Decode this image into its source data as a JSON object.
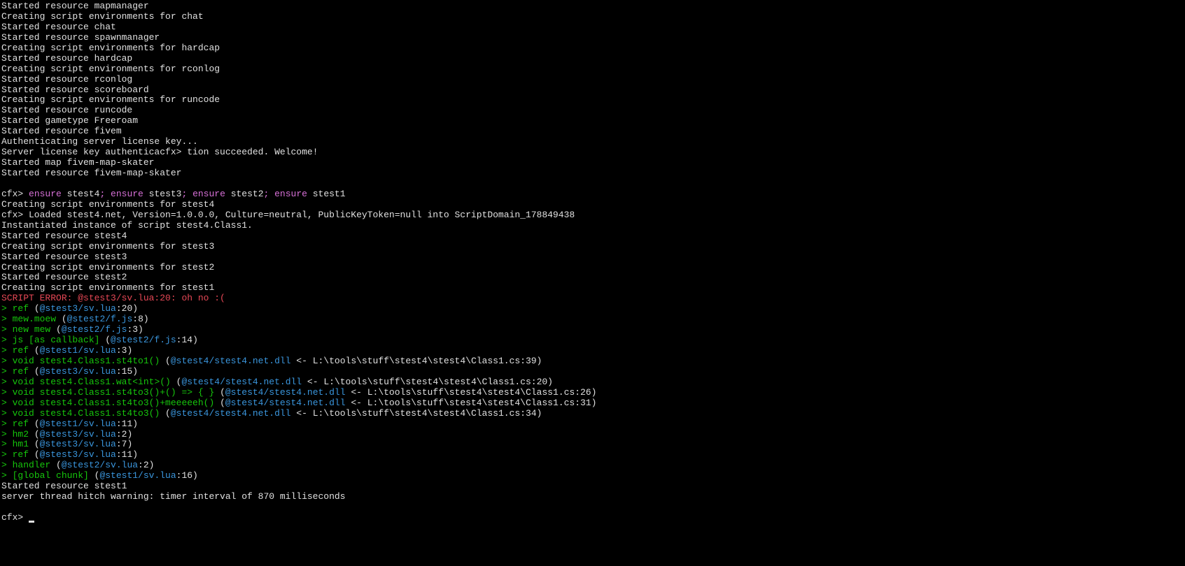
{
  "startup": {
    "l1": "Started resource mapmanager",
    "l2": "Creating script environments for chat",
    "l3": "Started resource chat",
    "l4": "Started resource spawnmanager",
    "l5": "Creating script environments for hardcap",
    "l6": "Started resource hardcap",
    "l7": "Creating script environments for rconlog",
    "l8": "Started resource rconlog",
    "l9": "Started resource scoreboard",
    "l10": "Creating script environments for runcode",
    "l11": "Started resource runcode",
    "l12": "Started gametype Freeroam",
    "l13": "Started resource fivem",
    "l14": "Authenticating server license key...",
    "l15": "Server license key authenticacfx> tion succeeded. Welcome!",
    "l16": "Started map fivem-map-skater",
    "l17": "Started resource fivem-map-skater"
  },
  "command": {
    "prompt": "cfx> ",
    "cmd1": "ensure",
    "arg1": " stest4",
    "sep1": "; ",
    "cmd2": "ensure",
    "arg2": " stest3",
    "sep2": "; ",
    "cmd3": "ensure",
    "arg3": " stest2",
    "sep3": "; ",
    "cmd4": "ensure",
    "arg4": " stest1"
  },
  "output": {
    "o1": "Creating script environments for stest4",
    "o2": "cfx> Loaded stest4.net, Version=1.0.0.0, Culture=neutral, PublicKeyToken=null into ScriptDomain_178849438",
    "o3": "Instantiated instance of script stest4.Class1.",
    "o4": "Started resource stest4",
    "o5": "Creating script environments for stest3",
    "o6": "Started resource stest3",
    "o7": "Creating script environments for stest2",
    "o8": "Started resource stest2",
    "o9": "Creating script environments for stest1"
  },
  "error": {
    "msg": "SCRIPT ERROR: @stest3/sv.lua:20: oh no :("
  },
  "trace": {
    "t1_pre": "> ",
    "t1_fn": "ref",
    "t1_sp": " (",
    "t1_file": "@stest3/sv.lua",
    "t1_ln": ":20)",
    "t2_pre": "> ",
    "t2_fn": "mew.moew",
    "t2_sp": " (",
    "t2_file": "@stest2/f.js",
    "t2_ln": ":8)",
    "t3_pre": "> ",
    "t3_fn": "new mew",
    "t3_sp": " (",
    "t3_file": "@stest2/f.js",
    "t3_ln": ":3)",
    "t4_pre": "> ",
    "t4_fn": "js [as callback]",
    "t4_sp": " (",
    "t4_file": "@stest2/f.js",
    "t4_ln": ":14)",
    "t5_pre": "> ",
    "t5_fn": "ref",
    "t5_sp": " (",
    "t5_file": "@stest1/sv.lua",
    "t5_ln": ":3)",
    "t6_pre": "> ",
    "t6_fn": "void stest4.Class1.st4to1()",
    "t6_sp": " (",
    "t6_file": "@stest4/stest4.net.dll",
    "t6_post": " <- L:\\tools\\stuff\\stest4\\stest4\\Class1.cs:39)",
    "t7_pre": "> ",
    "t7_fn": "ref",
    "t7_sp": " (",
    "t7_file": "@stest3/sv.lua",
    "t7_ln": ":15)",
    "t8_pre": "> ",
    "t8_fn": "void stest4.Class1.wat<int>()",
    "t8_sp": " (",
    "t8_file": "@stest4/stest4.net.dll",
    "t8_post": " <- L:\\tools\\stuff\\stest4\\stest4\\Class1.cs:20)",
    "t9_pre": "> ",
    "t9_fn": "void stest4.Class1.st4to3()+() => { }",
    "t9_sp": " (",
    "t9_file": "@stest4/stest4.net.dll",
    "t9_post": " <- L:\\tools\\stuff\\stest4\\stest4\\Class1.cs:26)",
    "t10_pre": "> ",
    "t10_fn": "void stest4.Class1.st4to3()+meeeeeh()",
    "t10_sp": " (",
    "t10_file": "@stest4/stest4.net.dll",
    "t10_post": " <- L:\\tools\\stuff\\stest4\\stest4\\Class1.cs:31)",
    "t11_pre": "> ",
    "t11_fn": "void stest4.Class1.st4to3()",
    "t11_sp": " (",
    "t11_file": "@stest4/stest4.net.dll",
    "t11_post": " <- L:\\tools\\stuff\\stest4\\stest4\\Class1.cs:34)",
    "t12_pre": "> ",
    "t12_fn": "ref",
    "t12_sp": " (",
    "t12_file": "@stest1/sv.lua",
    "t12_ln": ":11)",
    "t13_pre": "> ",
    "t13_fn": "hm2",
    "t13_sp": " (",
    "t13_file": "@stest3/sv.lua",
    "t13_ln": ":2)",
    "t14_pre": "> ",
    "t14_fn": "hm1",
    "t14_sp": " (",
    "t14_file": "@stest3/sv.lua",
    "t14_ln": ":7)",
    "t15_pre": "> ",
    "t15_fn": "ref",
    "t15_sp": " (",
    "t15_file": "@stest3/sv.lua",
    "t15_ln": ":11)",
    "t16_pre": "> ",
    "t16_fn": "handler",
    "t16_sp": " (",
    "t16_file": "@stest2/sv.lua",
    "t16_ln": ":2)",
    "t17_pre": "> ",
    "t17_fn": "[global chunk]",
    "t17_sp": " (",
    "t17_file": "@stest1/sv.lua",
    "t17_ln": ":16)"
  },
  "footer": {
    "f1": "Started resource stest1",
    "f2": "server thread hitch warning: timer interval of 870 milliseconds"
  },
  "prompt2": "cfx> "
}
